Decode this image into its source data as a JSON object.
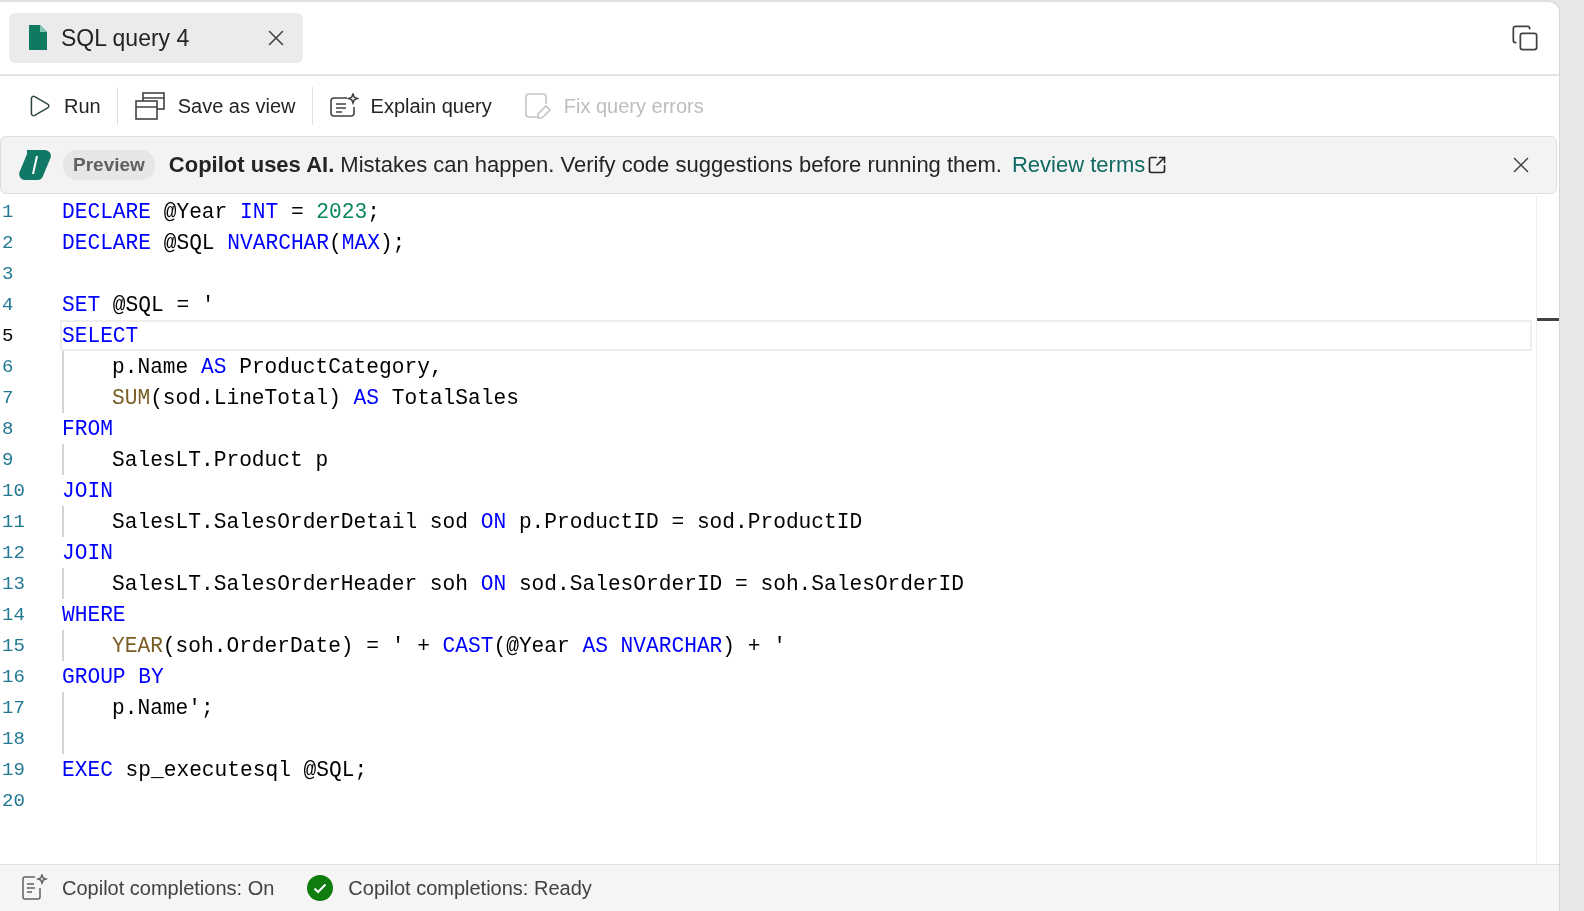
{
  "tab": {
    "title": "SQL query 4",
    "selected": true
  },
  "toolbar": [
    {
      "kind": "run",
      "label": "Run",
      "disabled": false
    },
    {
      "kind": "save-view",
      "label": "Save as view",
      "disabled": false
    },
    {
      "kind": "explain",
      "label": "Explain query",
      "disabled": false
    },
    {
      "kind": "fix",
      "label": "Fix query errors",
      "disabled": true
    }
  ],
  "banner": {
    "badge": "Preview",
    "message": "**Copilot uses AI.** Mistakes can happen. Verify code suggestions before running them.",
    "link": "Review terms"
  },
  "editor": {
    "lines": [
      {
        "number": "1",
        "current": false,
        "indented": false,
        "tokens": [
          {
            "kind": "keyword",
            "text": "DECLARE"
          },
          {
            "kind": "plain",
            "text": " @Year "
          },
          {
            "kind": "keyword",
            "text": "INT"
          },
          {
            "kind": "plain",
            "text": " = "
          },
          {
            "kind": "number",
            "text": "2023"
          },
          {
            "kind": "plain",
            "text": ";"
          }
        ]
      },
      {
        "number": "2",
        "current": false,
        "indented": false,
        "tokens": [
          {
            "kind": "keyword",
            "text": "DECLARE"
          },
          {
            "kind": "plain",
            "text": " @SQL "
          },
          {
            "kind": "keyword",
            "text": "NVARCHAR"
          },
          {
            "kind": "plain",
            "text": "("
          },
          {
            "kind": "keyword",
            "text": "MAX"
          },
          {
            "kind": "plain",
            "text": ");"
          }
        ]
      },
      {
        "number": "3",
        "current": false,
        "indented": false
      },
      {
        "number": "4",
        "current": false,
        "indented": false,
        "tokens": [
          {
            "kind": "keyword",
            "text": "SET"
          },
          {
            "kind": "plain",
            "text": " @SQL = '"
          }
        ]
      },
      {
        "number": "5",
        "current": true,
        "indented": false,
        "tokens": [
          {
            "kind": "keyword",
            "text": "SELECT"
          }
        ]
      },
      {
        "number": "6",
        "current": false,
        "indented": true,
        "tokens": [
          {
            "kind": "plain",
            "text": "p.Name "
          },
          {
            "kind": "keyword",
            "text": "AS"
          },
          {
            "kind": "plain",
            "text": " ProductCategory,"
          }
        ]
      },
      {
        "number": "7",
        "current": false,
        "indented": true,
        "tokens": [
          {
            "kind": "function",
            "text": "SUM"
          },
          {
            "kind": "plain",
            "text": "(sod.LineTotal) "
          },
          {
            "kind": "keyword",
            "text": "AS"
          },
          {
            "kind": "plain",
            "text": " TotalSales"
          }
        ]
      },
      {
        "number": "8",
        "current": false,
        "indented": false,
        "tokens": [
          {
            "kind": "keyword",
            "text": "FROM"
          }
        ]
      },
      {
        "number": "9",
        "current": false,
        "indented": true,
        "tokens": [
          {
            "kind": "plain",
            "text": "SalesLT.Product p"
          }
        ]
      },
      {
        "number": "10",
        "current": false,
        "indented": false,
        "tokens": [
          {
            "kind": "keyword",
            "text": "JOIN"
          }
        ]
      },
      {
        "number": "11",
        "current": false,
        "indented": true,
        "tokens": [
          {
            "kind": "plain",
            "text": "SalesLT.SalesOrderDetail sod "
          },
          {
            "kind": "keyword",
            "text": "ON"
          },
          {
            "kind": "plain",
            "text": " p.ProductID = sod.ProductID"
          }
        ]
      },
      {
        "number": "12",
        "current": false,
        "indented": false,
        "tokens": [
          {
            "kind": "keyword",
            "text": "JOIN"
          }
        ]
      },
      {
        "number": "13",
        "current": false,
        "indented": true,
        "tokens": [
          {
            "kind": "plain",
            "text": "SalesLT.SalesOrderHeader soh "
          },
          {
            "kind": "keyword",
            "text": "ON"
          },
          {
            "kind": "plain",
            "text": " sod.SalesOrderID = soh.SalesOrderID"
          }
        ]
      },
      {
        "number": "14",
        "current": false,
        "indented": false,
        "tokens": [
          {
            "kind": "keyword",
            "text": "WHERE"
          }
        ]
      },
      {
        "number": "15",
        "current": false,
        "indented": true,
        "tokens": [
          {
            "kind": "function",
            "text": "YEAR"
          },
          {
            "kind": "plain",
            "text": "(soh.OrderDate) = ' + "
          },
          {
            "kind": "keyword",
            "text": "CAST"
          },
          {
            "kind": "plain",
            "text": "(@Year "
          },
          {
            "kind": "keyword",
            "text": "AS NVARCHAR"
          },
          {
            "kind": "plain",
            "text": ") + '"
          }
        ]
      },
      {
        "number": "16",
        "current": false,
        "indented": false,
        "tokens": [
          {
            "kind": "keyword",
            "text": "GROUP BY"
          }
        ]
      },
      {
        "number": "17",
        "current": false,
        "indented": true,
        "tokens": [
          {
            "kind": "plain",
            "text": "p.Name';"
          }
        ]
      },
      {
        "number": "18",
        "current": false,
        "indented": true
      },
      {
        "number": "19",
        "current": false,
        "indented": false,
        "tokens": [
          {
            "kind": "keyword",
            "text": "EXEC"
          },
          {
            "kind": "plain",
            "text": " sp_executesql @SQL;"
          }
        ]
      },
      {
        "number": "20",
        "current": false,
        "indented": false
      }
    ]
  },
  "status_bar": [
    {
      "kind": "copilot",
      "label": "Copilot completions: On"
    },
    {
      "kind": "ready",
      "label": "Copilot completions: Ready"
    }
  ]
}
